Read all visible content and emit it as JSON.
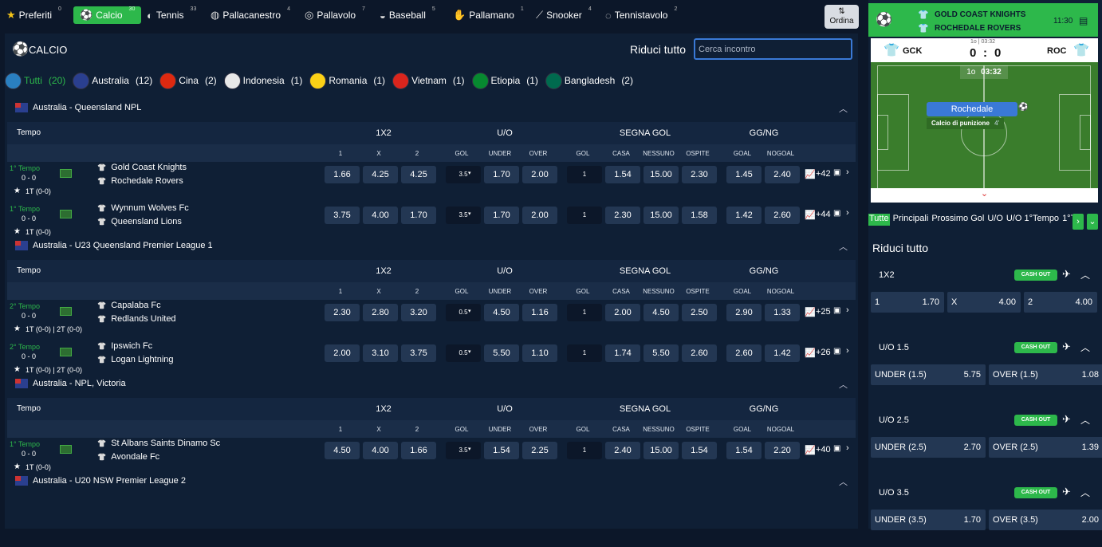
{
  "sports": [
    {
      "label": "Preferiti",
      "count": "0",
      "icon": "star-icon",
      "glyph": "★"
    },
    {
      "label": "Calcio",
      "count": "30",
      "icon": "soccer-ball-icon",
      "glyph": "⚽"
    },
    {
      "label": "Tennis",
      "count": "33",
      "icon": "tennis-ball-icon",
      "glyph": "◐"
    },
    {
      "label": "Pallacanestro",
      "count": "4",
      "icon": "basketball-icon",
      "glyph": "◍"
    },
    {
      "label": "Pallavolo",
      "count": "7",
      "icon": "volleyball-icon",
      "glyph": "◎"
    },
    {
      "label": "Baseball",
      "count": "5",
      "icon": "baseball-icon",
      "glyph": "◒"
    },
    {
      "label": "Pallamano",
      "count": "1",
      "icon": "handball-icon",
      "glyph": "✋"
    },
    {
      "label": "Snooker",
      "count": "4",
      "icon": "snooker-cue-icon",
      "glyph": "⟋"
    },
    {
      "label": "Tennistavolo",
      "count": "2",
      "icon": "table-tennis-icon",
      "glyph": "◌"
    }
  ],
  "ordina_label": "Ordina",
  "section_title": "CALCIO",
  "riduci_label": "Riduci tutto",
  "search_placeholder": "Cerca incontro",
  "countries": [
    {
      "label": "Tutti",
      "count": "(20)",
      "color": "#2a7fc0"
    },
    {
      "label": "Australia",
      "count": "(12)",
      "color": "#2a3f8f"
    },
    {
      "label": "Cina",
      "count": "(2)",
      "color": "#de2910"
    },
    {
      "label": "Indonesia",
      "count": "(1)",
      "color": "#e8e8e8"
    },
    {
      "label": "Romania",
      "count": "(1)",
      "color": "#fcd116"
    },
    {
      "label": "Vietnam",
      "count": "(1)",
      "color": "#da251d"
    },
    {
      "label": "Etiopia",
      "count": "(1)",
      "color": "#078930"
    },
    {
      "label": "Bangladesh",
      "count": "(2)",
      "color": "#006a4e"
    }
  ],
  "col_groups": [
    "Tempo",
    "1X2",
    "U/O",
    "SEGNA GOL",
    "GG/NG"
  ],
  "sub_cols": [
    "1",
    "X",
    "2",
    "GOL",
    "UNDER",
    "OVER",
    "GOL",
    "CASA",
    "NESSUNO",
    "OSPITE",
    "GOAL",
    "NOGOAL"
  ],
  "leagues": [
    {
      "name": "Australia - Queensland NPL",
      "matches": [
        {
          "period": "1° Tempo",
          "score": "0 - 0",
          "half": "1T (0-0)",
          "home": "Gold Coast Knights",
          "away": "Rochedale Rovers",
          "odds": [
            "1.66",
            "4.25",
            "4.25",
            "3.5",
            "1.70",
            "2.00",
            "1",
            "1.54",
            "15.00",
            "2.30",
            "1.45",
            "2.40"
          ],
          "more": "+42"
        },
        {
          "period": "1° Tempo",
          "score": "0 - 0",
          "half": "1T (0-0)",
          "home": "Wynnum Wolves Fc",
          "away": "Queensland Lions",
          "odds": [
            "3.75",
            "4.00",
            "1.70",
            "3.5",
            "1.70",
            "2.00",
            "1",
            "2.30",
            "15.00",
            "1.58",
            "1.42",
            "2.60"
          ],
          "more": "+44"
        }
      ]
    },
    {
      "name": "Australia - U23 Queensland Premier League 1",
      "matches": [
        {
          "period": "2° Tempo",
          "score": "0 - 0",
          "half": "1T (0-0) | 2T (0-0)",
          "home": "Capalaba Fc",
          "away": "Redlands United",
          "odds": [
            "2.30",
            "2.80",
            "3.20",
            "0.5",
            "4.50",
            "1.16",
            "1",
            "2.00",
            "4.50",
            "2.50",
            "2.90",
            "1.33"
          ],
          "more": "+25"
        },
        {
          "period": "2° Tempo",
          "score": "0 - 0",
          "half": "1T (0-0) | 2T (0-0)",
          "home": "Ipswich Fc",
          "away": "Logan Lightning",
          "odds": [
            "2.00",
            "3.10",
            "3.75",
            "0.5",
            "5.50",
            "1.10",
            "1",
            "1.74",
            "5.50",
            "2.60",
            "2.60",
            "1.42"
          ],
          "more": "+26"
        }
      ]
    },
    {
      "name": "Australia - NPL, Victoria",
      "matches": [
        {
          "period": "1° Tempo",
          "score": "0 - 0",
          "half": "1T (0-0)",
          "home": "St Albans Saints Dinamo Sc",
          "away": "Avondale Fc",
          "odds": [
            "4.50",
            "4.00",
            "1.66",
            "3.5",
            "1.54",
            "2.25",
            "1",
            "2.40",
            "15.00",
            "1.54",
            "1.54",
            "2.20"
          ],
          "more": "+40"
        }
      ]
    },
    {
      "name": "Australia - U20 NSW Premier League 2",
      "matches": []
    }
  ],
  "live": {
    "home_name": "GOLD COAST KNIGHTS",
    "away_name": "ROCHEDALE ROVERS",
    "time": "11:30",
    "home_abbr": "GCK",
    "away_abbr": "ROC",
    "score_home": "0",
    "score_sep": ":",
    "score_away": "0",
    "small_time": "1o | 03:32",
    "period_label": "1o",
    "clock": "03:32",
    "event_team": "Rochedale",
    "event_text": "Calcio di punizione",
    "event_min": "4'"
  },
  "market_tabs": [
    "Tutte",
    "Principali",
    "Prossimo Gol",
    "U/O",
    "U/O 1°Tempo",
    "1°Te"
  ],
  "side_riduci": "Riduci tutto",
  "cashout_label": "CASH OUT",
  "markets": [
    {
      "title": "1X2",
      "sels": [
        {
          "l": "1",
          "v": "1.70"
        },
        {
          "l": "X",
          "v": "4.00"
        },
        {
          "l": "2",
          "v": "4.00"
        }
      ]
    },
    {
      "title": "U/O 1.5",
      "sels": [
        {
          "l": "UNDER (1.5)",
          "v": "5.75"
        },
        {
          "l": "OVER (1.5)",
          "v": "1.08"
        }
      ]
    },
    {
      "title": "U/O 2.5",
      "sels": [
        {
          "l": "UNDER (2.5)",
          "v": "2.70"
        },
        {
          "l": "OVER (2.5)",
          "v": "1.39"
        }
      ]
    },
    {
      "title": "U/O 3.5",
      "sels": [
        {
          "l": "UNDER (3.5)",
          "v": "1.70"
        },
        {
          "l": "OVER (3.5)",
          "v": "2.00"
        }
      ]
    }
  ]
}
